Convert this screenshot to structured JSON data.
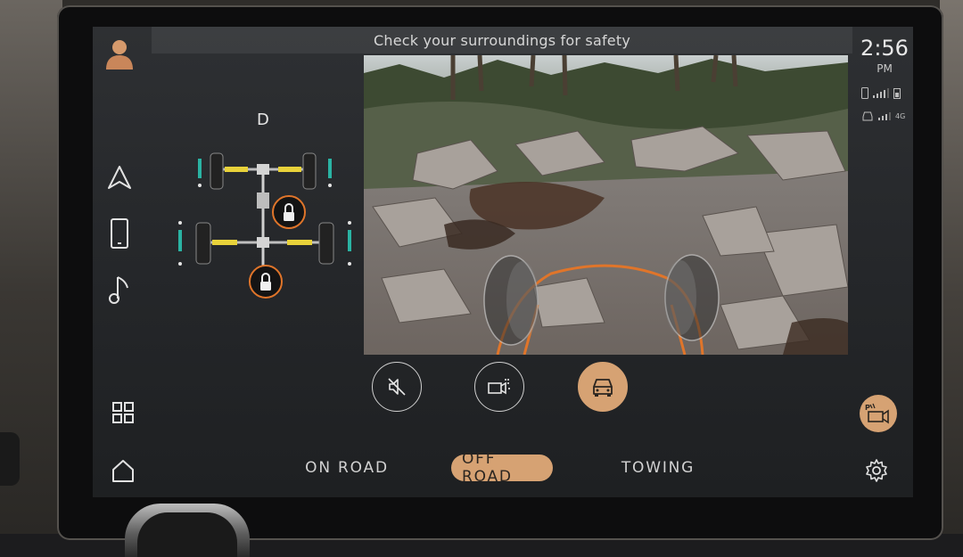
{
  "banner": {
    "text": "Check your surroundings for safety"
  },
  "status": {
    "time": "2:56",
    "ampm": "PM",
    "phone_network": "",
    "car_network": "4G"
  },
  "drivetrain": {
    "gear": "D",
    "center_diff": "locked",
    "rear_diff": "locked"
  },
  "controls": {
    "mute_icon": "speaker-muted-icon",
    "camera_view_icon": "camera-switch-icon",
    "vehicle_view_icon": "car-front-icon",
    "vehicle_view_active": true
  },
  "modes": {
    "tabs": [
      {
        "label": "ON ROAD",
        "active": false
      },
      {
        "label": "OFF ROAD",
        "active": true
      },
      {
        "label": "TOWING",
        "active": false
      }
    ]
  },
  "nav_icons": [
    "profile-icon",
    "navigation-icon",
    "phone-icon",
    "music-icon",
    "apps-grid-icon",
    "home-icon"
  ],
  "colors": {
    "accent": "#d6a273",
    "trajectory": "#e0752a",
    "spring": "#e8d23a",
    "sensor": "#2ab3a3"
  }
}
